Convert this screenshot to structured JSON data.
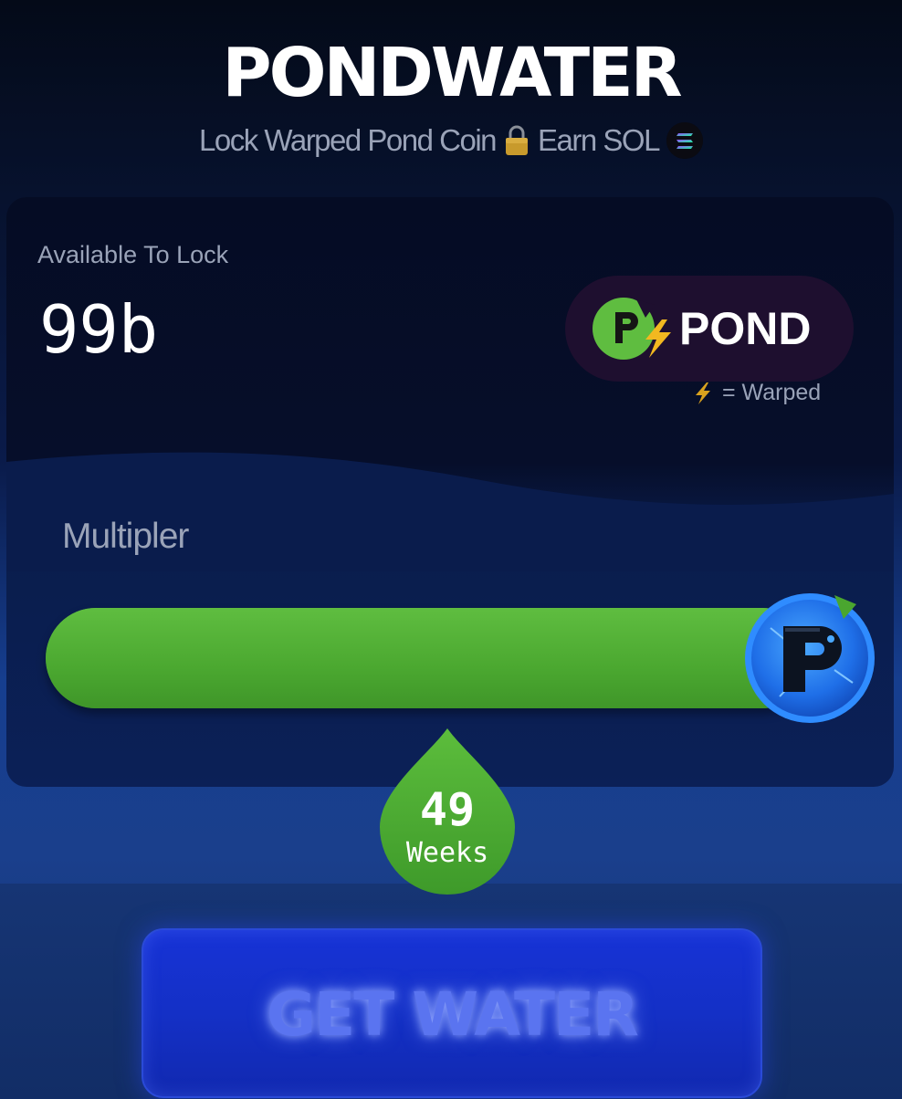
{
  "header": {
    "title": "PONDWATER",
    "subtitle_before": "Lock Warped Pond Coin",
    "subtitle_after": "Earn SOL"
  },
  "lock_card": {
    "available_label": "Available To Lock",
    "available_value": "99b",
    "token_symbol": "POND",
    "warped_note": "= Warped",
    "multiplier_label": "Multipler",
    "slider_fraction": 1.0
  },
  "weeks": {
    "value": "49",
    "unit": "Weeks"
  },
  "cta": {
    "label": "GET WATER"
  },
  "colors": {
    "accent_green": "#4aa62f",
    "button_blue": "#1430c6",
    "token_pill": "#1e0f2f",
    "muted_text": "#9aa3b8",
    "bolt_yellow": "#f2b820"
  },
  "icons": {
    "lock": "lock-icon",
    "solana": "solana-icon",
    "token": "pond-token-icon",
    "bolt": "bolt-icon",
    "slider_thumb": "pond-coin-thumb-icon"
  }
}
